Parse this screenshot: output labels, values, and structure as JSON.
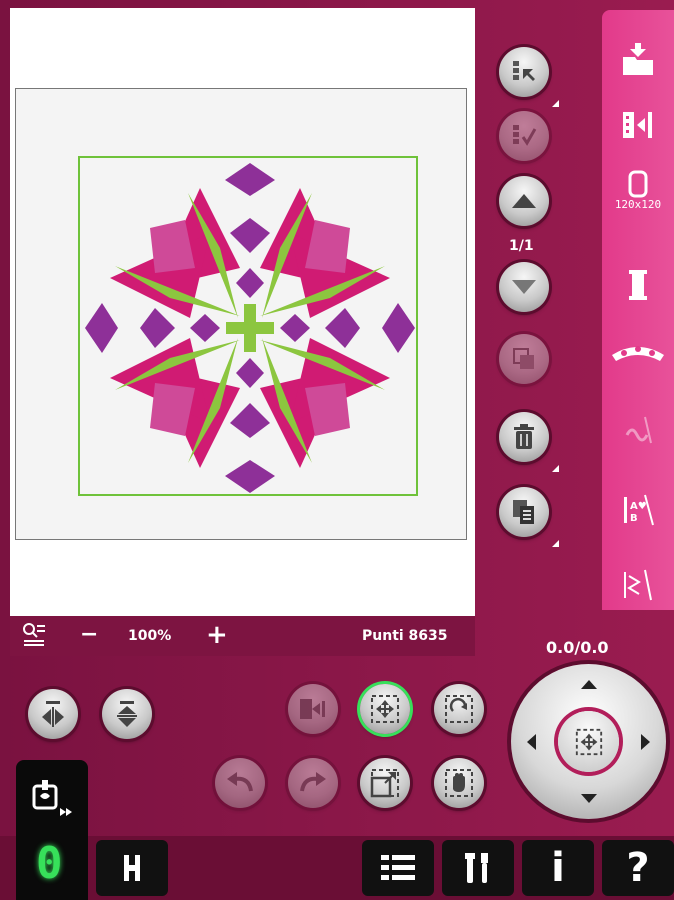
{
  "zoom": {
    "level": "100%",
    "minus": "−",
    "plus": "+"
  },
  "stitches": {
    "label": "Punti 8635"
  },
  "selection": {
    "page": "1/1"
  },
  "position": {
    "readout": "0.0/0.0"
  },
  "hoop": {
    "size": "120x120"
  },
  "sidebar": {
    "items": [
      {
        "name": "load-design"
      },
      {
        "name": "mirror-side-to-side"
      },
      {
        "name": "hoop-selection"
      },
      {
        "name": "thread-colors"
      },
      {
        "name": "design-shaping"
      },
      {
        "name": "stipple"
      },
      {
        "name": "monogram"
      },
      {
        "name": "edit-stitches"
      }
    ]
  },
  "colors": {
    "background": "#8a1746",
    "accent": "#e23a8a",
    "magenta": "#d01b73",
    "pink": "#cf4a98",
    "purple": "#8e3098",
    "green": "#8cc63f",
    "hoop_outline": "#6fc23a",
    "active_green": "#37e05a"
  },
  "bottom_bar": {
    "mode_digit": "0",
    "help": "?",
    "info": "i"
  }
}
